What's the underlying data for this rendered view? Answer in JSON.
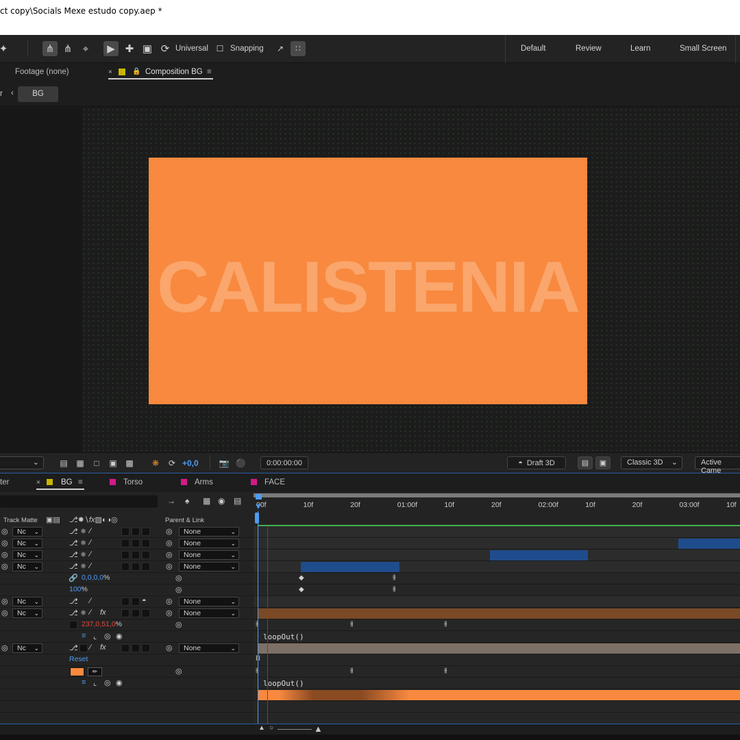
{
  "title": "ct copy\\Socials Mexe estudo copy.aep *",
  "toolbar": {
    "universal_label": "Universal",
    "snapping_label": "Snapping",
    "workspaces": [
      "Default",
      "Review",
      "Learn",
      "Small Screen"
    ]
  },
  "panel_tabs": {
    "footage": "Footage (none)",
    "composition": "Composition BG"
  },
  "breadcrumb": {
    "prefix": "r",
    "current": "BG"
  },
  "composition": {
    "text": "CALISTENIA",
    "bg_color": "#f8893f"
  },
  "viewer_bar": {
    "exposure": "+0,0",
    "timecode": "0:00:00:00",
    "renderer": "Draft 3D",
    "renderer_mode": "Classic 3D",
    "camera": "Active Came"
  },
  "timeline_tabs": {
    "first": "ter",
    "tabs": [
      "BG",
      "Torso",
      "Arms",
      "FACE"
    ]
  },
  "timeline_header": {
    "track_matte": "Track Matte",
    "parent_link": "Parent & Link"
  },
  "ruler_ticks": [
    "00f",
    "10f",
    "20f",
    "01:00f",
    "10f",
    "20f",
    "02:00f",
    "10f",
    "20f",
    "03:00f",
    "10f"
  ],
  "rows": {
    "matte": "Nc",
    "parent": "None",
    "scale_value": "0,0,0,0",
    "scale_unit": "%",
    "opacity_value": "100",
    "opacity_unit": "%",
    "color_value": "237,0,51,0",
    "color_unit": "%",
    "expression": "loopOut()",
    "reset": "Reset"
  }
}
